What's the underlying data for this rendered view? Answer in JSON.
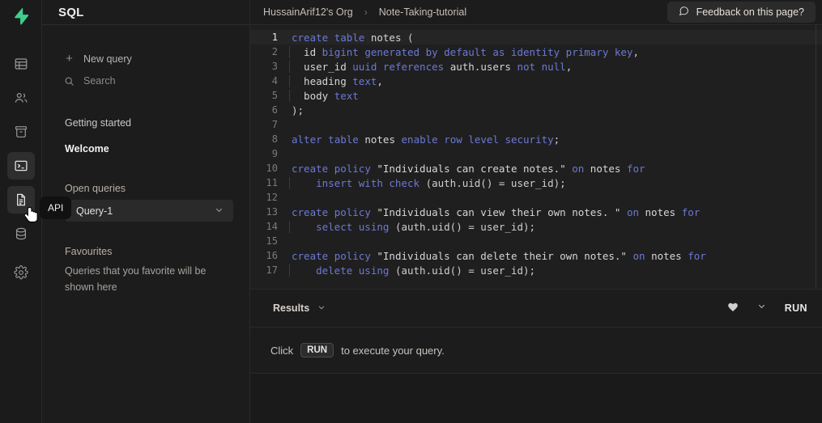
{
  "rail": {
    "logo": "supabase-logo",
    "items": [
      {
        "name": "table-editor",
        "icon": "table-icon",
        "active": false
      },
      {
        "name": "authentication",
        "icon": "users-icon",
        "active": false
      },
      {
        "name": "storage",
        "icon": "archive-icon",
        "active": false
      },
      {
        "name": "sql-editor",
        "icon": "terminal-icon",
        "active": true
      },
      {
        "name": "api-docs",
        "icon": "document-icon",
        "active": true
      },
      {
        "name": "database",
        "icon": "database-icon",
        "active": false
      },
      {
        "name": "settings",
        "icon": "gear-icon",
        "active": false
      }
    ],
    "tooltip": "API"
  },
  "sidebar": {
    "title": "SQL",
    "new_query": "New query",
    "search_placeholder": "Search",
    "getting_started_label": "Getting started",
    "welcome_label": "Welcome",
    "open_queries_label": "Open queries",
    "open_queries": [
      {
        "label": "Query-1"
      }
    ],
    "favourites_label": "Favourites",
    "favourites_empty": "Queries that you favorite will be shown here"
  },
  "topbar": {
    "org": "HussainArif12's Org",
    "separator": "›",
    "project": "Note-Taking-tutorial",
    "feedback": "Feedback on this page?"
  },
  "editor": {
    "active_line": 1,
    "lines": [
      {
        "n": 1,
        "indent": false,
        "tokens": [
          {
            "t": "kw",
            "v": "create"
          },
          {
            "t": "punct",
            "v": " "
          },
          {
            "t": "kw",
            "v": "table"
          },
          {
            "t": "punct",
            "v": " "
          },
          {
            "t": "id",
            "v": "notes"
          },
          {
            "t": "punct",
            "v": " ("
          }
        ]
      },
      {
        "n": 2,
        "indent": true,
        "tokens": [
          {
            "t": "id",
            "v": "  id"
          },
          {
            "t": "punct",
            "v": " "
          },
          {
            "t": "kw",
            "v": "bigint generated by default as identity primary key"
          },
          {
            "t": "punct",
            "v": ","
          }
        ]
      },
      {
        "n": 3,
        "indent": true,
        "tokens": [
          {
            "t": "id",
            "v": "  user_id"
          },
          {
            "t": "punct",
            "v": " "
          },
          {
            "t": "kw",
            "v": "uuid references"
          },
          {
            "t": "punct",
            "v": " "
          },
          {
            "t": "id",
            "v": "auth.users"
          },
          {
            "t": "punct",
            "v": " "
          },
          {
            "t": "kw",
            "v": "not null"
          },
          {
            "t": "punct",
            "v": ","
          }
        ]
      },
      {
        "n": 4,
        "indent": true,
        "tokens": [
          {
            "t": "id",
            "v": "  heading"
          },
          {
            "t": "punct",
            "v": " "
          },
          {
            "t": "kw",
            "v": "text"
          },
          {
            "t": "punct",
            "v": ","
          }
        ]
      },
      {
        "n": 5,
        "indent": true,
        "tokens": [
          {
            "t": "id",
            "v": "  body"
          },
          {
            "t": "punct",
            "v": " "
          },
          {
            "t": "kw",
            "v": "text"
          }
        ]
      },
      {
        "n": 6,
        "indent": false,
        "tokens": [
          {
            "t": "punct",
            "v": ");"
          }
        ]
      },
      {
        "n": 7,
        "indent": false,
        "tokens": []
      },
      {
        "n": 8,
        "indent": false,
        "tokens": [
          {
            "t": "kw",
            "v": "alter"
          },
          {
            "t": "punct",
            "v": " "
          },
          {
            "t": "kw",
            "v": "table"
          },
          {
            "t": "punct",
            "v": " "
          },
          {
            "t": "id",
            "v": "notes"
          },
          {
            "t": "punct",
            "v": " "
          },
          {
            "t": "kw",
            "v": "enable row level security"
          },
          {
            "t": "punct",
            "v": ";"
          }
        ]
      },
      {
        "n": 9,
        "indent": false,
        "tokens": []
      },
      {
        "n": 10,
        "indent": false,
        "tokens": [
          {
            "t": "kw",
            "v": "create"
          },
          {
            "t": "punct",
            "v": " "
          },
          {
            "t": "kw",
            "v": "policy"
          },
          {
            "t": "punct",
            "v": " "
          },
          {
            "t": "str",
            "v": "\"Individuals can create notes.\""
          },
          {
            "t": "punct",
            "v": " "
          },
          {
            "t": "kw",
            "v": "on"
          },
          {
            "t": "punct",
            "v": " "
          },
          {
            "t": "id",
            "v": "notes"
          },
          {
            "t": "punct",
            "v": " "
          },
          {
            "t": "kw",
            "v": "for"
          }
        ]
      },
      {
        "n": 11,
        "indent": true,
        "tokens": [
          {
            "t": "kw",
            "v": "    insert with check"
          },
          {
            "t": "punct",
            "v": " (auth.uid() = user_id);"
          }
        ]
      },
      {
        "n": 12,
        "indent": true,
        "tokens": []
      },
      {
        "n": 13,
        "indent": false,
        "tokens": [
          {
            "t": "kw",
            "v": "create"
          },
          {
            "t": "punct",
            "v": " "
          },
          {
            "t": "kw",
            "v": "policy"
          },
          {
            "t": "punct",
            "v": " "
          },
          {
            "t": "str",
            "v": "\"Individuals can view their own notes. \""
          },
          {
            "t": "punct",
            "v": " "
          },
          {
            "t": "kw",
            "v": "on"
          },
          {
            "t": "punct",
            "v": " "
          },
          {
            "t": "id",
            "v": "notes"
          },
          {
            "t": "punct",
            "v": " "
          },
          {
            "t": "kw",
            "v": "for"
          }
        ]
      },
      {
        "n": 14,
        "indent": true,
        "tokens": [
          {
            "t": "kw",
            "v": "    select using"
          },
          {
            "t": "punct",
            "v": " (auth.uid() = user_id);"
          }
        ]
      },
      {
        "n": 15,
        "indent": true,
        "tokens": []
      },
      {
        "n": 16,
        "indent": false,
        "tokens": [
          {
            "t": "kw",
            "v": "create"
          },
          {
            "t": "punct",
            "v": " "
          },
          {
            "t": "kw",
            "v": "policy"
          },
          {
            "t": "punct",
            "v": " "
          },
          {
            "t": "str",
            "v": "\"Individuals can delete their own notes.\""
          },
          {
            "t": "punct",
            "v": " "
          },
          {
            "t": "kw",
            "v": "on"
          },
          {
            "t": "punct",
            "v": " "
          },
          {
            "t": "id",
            "v": "notes"
          },
          {
            "t": "punct",
            "v": " "
          },
          {
            "t": "kw",
            "v": "for"
          }
        ]
      },
      {
        "n": 17,
        "indent": true,
        "tokens": [
          {
            "t": "kw",
            "v": "    delete using"
          },
          {
            "t": "punct",
            "v": " (auth.uid() = user_id);"
          }
        ]
      }
    ]
  },
  "results": {
    "tab_label": "Results",
    "favorite_icon": "heart-icon",
    "chevron_icon": "chevron-down-icon",
    "run_label": "RUN",
    "hint_prefix": "Click",
    "hint_key": "RUN",
    "hint_suffix": "to execute your query."
  },
  "colors": {
    "accent_green": "#3ECF8E",
    "keyword_blue": "#6C79D4",
    "bg": "#1c1c1c",
    "editor_bg": "#1f1f1f"
  }
}
